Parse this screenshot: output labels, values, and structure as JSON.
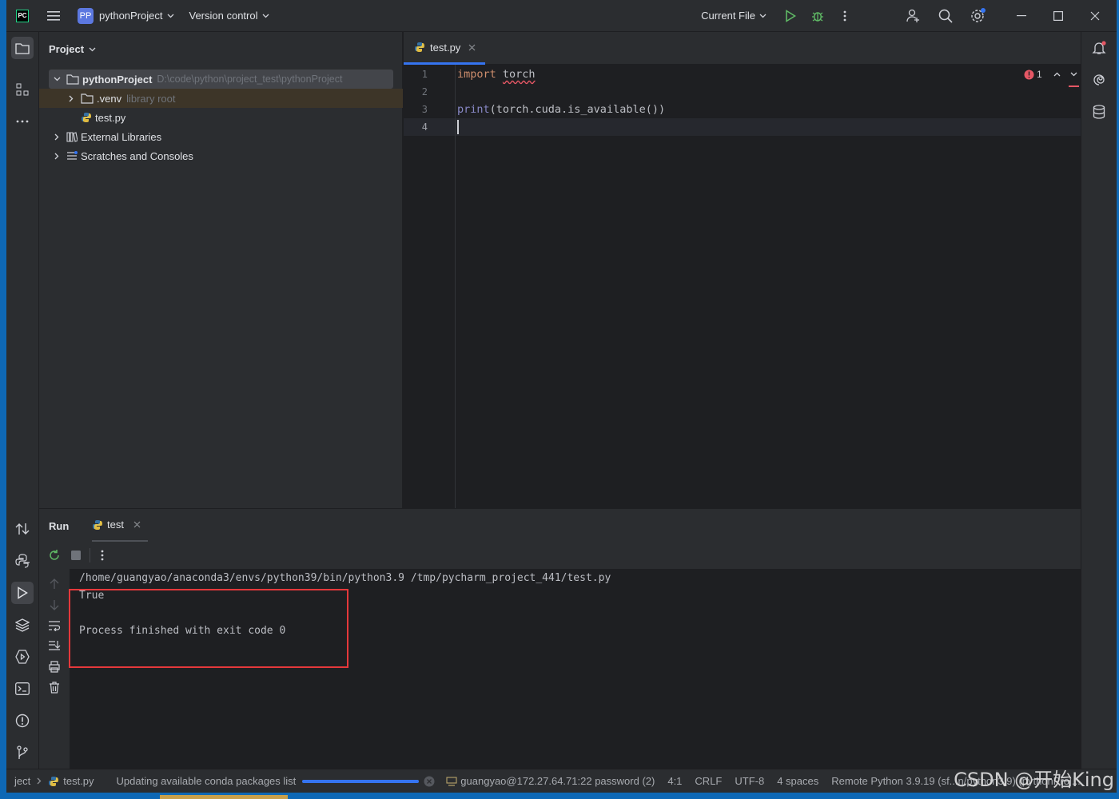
{
  "titlebar": {
    "project_badge": "PP",
    "project_name": "pythonProject",
    "vcs_label": "Version control",
    "run_config": "Current File"
  },
  "project_panel": {
    "title": "Project",
    "tree": [
      {
        "label": "pythonProject",
        "hint": "D:\\code\\python\\project_test\\pythonProject"
      },
      {
        "label": ".venv",
        "hint": "library root"
      },
      {
        "label": "test.py",
        "hint": ""
      },
      {
        "label": "External Libraries",
        "hint": ""
      },
      {
        "label": "Scratches and Consoles",
        "hint": ""
      }
    ]
  },
  "editor": {
    "tab_label": "test.py",
    "error_count": "1",
    "line_numbers": [
      "1",
      "2",
      "3",
      "4"
    ],
    "code": {
      "l1_kw": "import",
      "l1_mod": "torch",
      "l3_fn": "print",
      "l3_rest": "(torch.cuda.is_available())"
    }
  },
  "run_panel": {
    "title": "Run",
    "tab_label": "test",
    "console": [
      "/home/guangyao/anaconda3/envs/python39/bin/python3.9 /tmp/pycharm_project_441/test.py",
      "True",
      "",
      "Process finished with exit code 0"
    ]
  },
  "statusbar": {
    "crumb_project": "ject",
    "crumb_file": "test.py",
    "task_text": "Updating available conda packages list",
    "task_progress": 1.0,
    "connection": "guangyao@172.27.64.71:22 password (2)",
    "position": "4:1",
    "line_sep": "CRLF",
    "encoding": "UTF-8",
    "indent": "4 spaces",
    "interpreter": "Remote Python 3.9.19 (sf...n/python3.9) (pythonProj...",
    "watermark": "CSDN @开始King"
  },
  "colors": {
    "accent": "#3574f0",
    "keyword": "#cf8e6d",
    "highlight_box": "#e5383b"
  }
}
